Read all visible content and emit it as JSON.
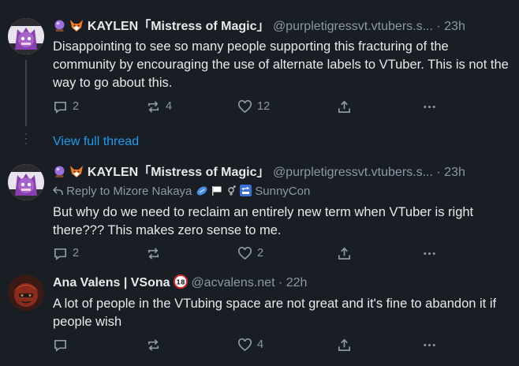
{
  "posts": [
    {
      "author": "KAYLEN「Mistress of Magic」",
      "handle": "@purpletigressvt.vtubers.s...",
      "time": "· 23h",
      "text": "Disappointing to see so many people supporting this fracturing of the community by encouraging the use of alternate labels to VTuber. This is not the way to go about this.",
      "replies": "2",
      "reposts": "4",
      "likes": "12"
    },
    {
      "author": "KAYLEN「Mistress of Magic」",
      "handle": "@purpletigressvt.vtubers.s...",
      "time": "· 23h",
      "reply_prefix": "Reply to Mizore Nakaya",
      "reply_suffix": "SunnyCon",
      "text": "But why do we need to reclaim an entirely new term when VTuber is right there??? This makes zero sense to me.",
      "replies": "2",
      "reposts": "",
      "likes": "2"
    },
    {
      "author": "Ana Valens | VSona",
      "handle": "@acvalens.net",
      "time": "· 22h",
      "text": "A lot of people in the VTubing space are not great and it's fine to abandon it if people wish",
      "replies": "",
      "reposts": "",
      "likes": "4"
    }
  ],
  "view_full_thread": "View full thread",
  "colors": {
    "background": "#181e24",
    "muted": "#8b98a5",
    "link": "#1d9bf0",
    "text": "#e7e9ea"
  }
}
